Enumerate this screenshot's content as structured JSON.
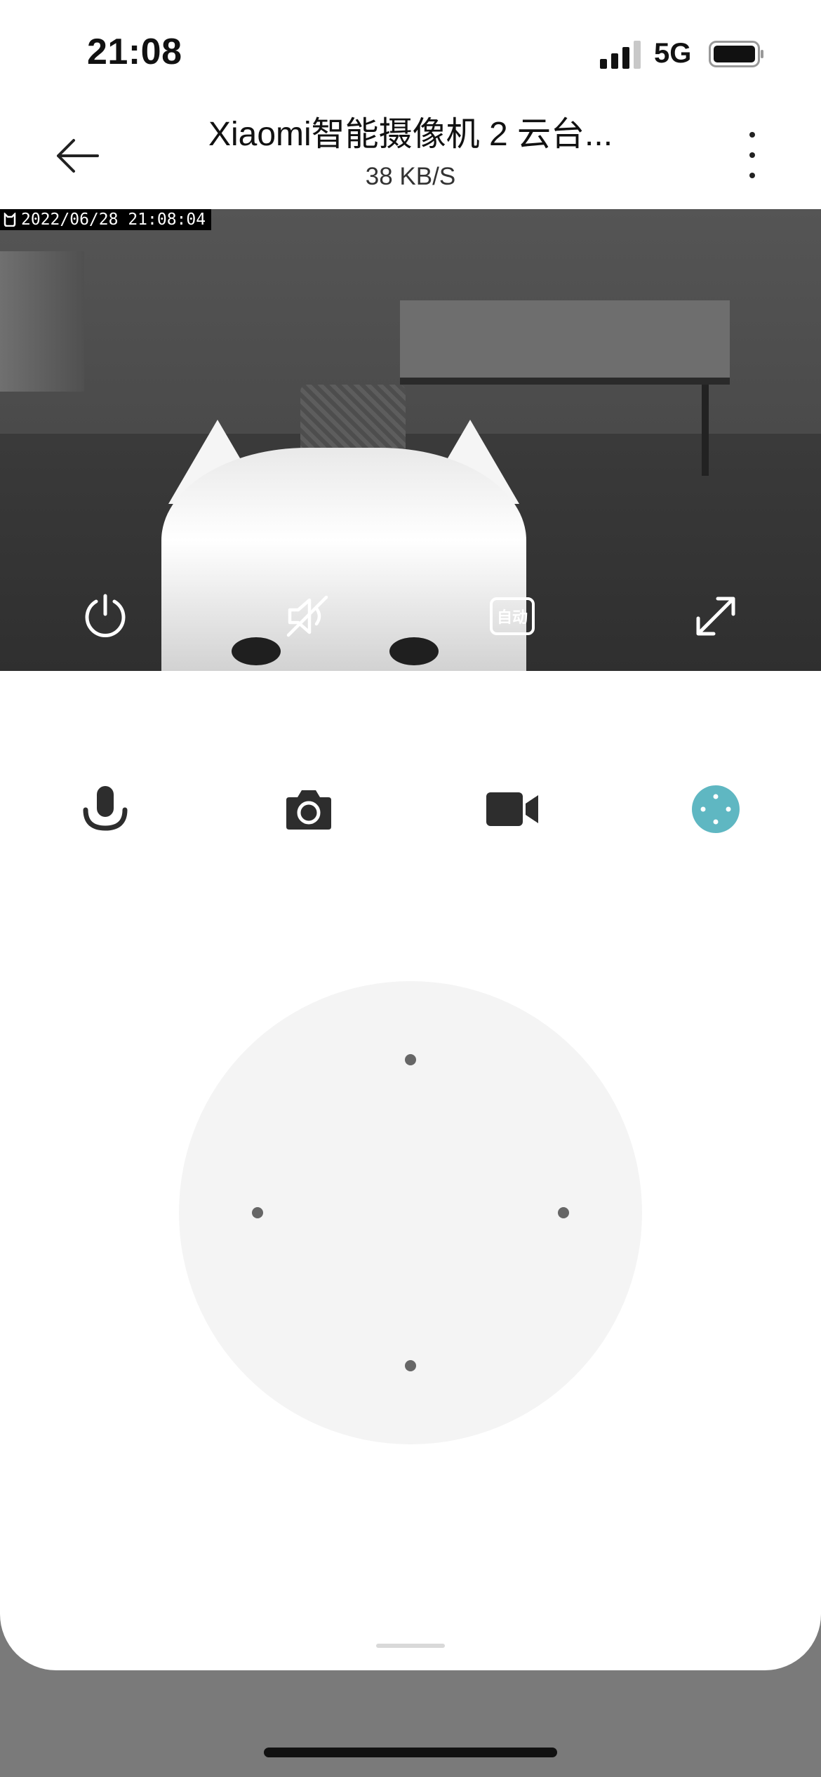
{
  "status_bar": {
    "time": "21:08",
    "network": "5G"
  },
  "header": {
    "title": "Xiaomi智能摄像机 2 云台...",
    "speed": "38 KB/S"
  },
  "video": {
    "timestamp": "2022/06/28 21:08:04",
    "controls": {
      "power_icon": "power-icon",
      "mute_icon": "speaker-muted-icon",
      "quality_label": "自动",
      "fullscreen_icon": "expand-icon"
    }
  },
  "actions": [
    {
      "name": "talk",
      "icon": "microphone-icon"
    },
    {
      "name": "snapshot",
      "icon": "camera-icon"
    },
    {
      "name": "record",
      "icon": "video-camera-icon"
    },
    {
      "name": "ptz",
      "icon": "direction-pad-icon",
      "active_color": "#5fb7c2"
    }
  ],
  "colors": {
    "accent": "#5fb7c2",
    "pad_bg": "#f4f4f4",
    "overlay": "#7a7a7a"
  }
}
